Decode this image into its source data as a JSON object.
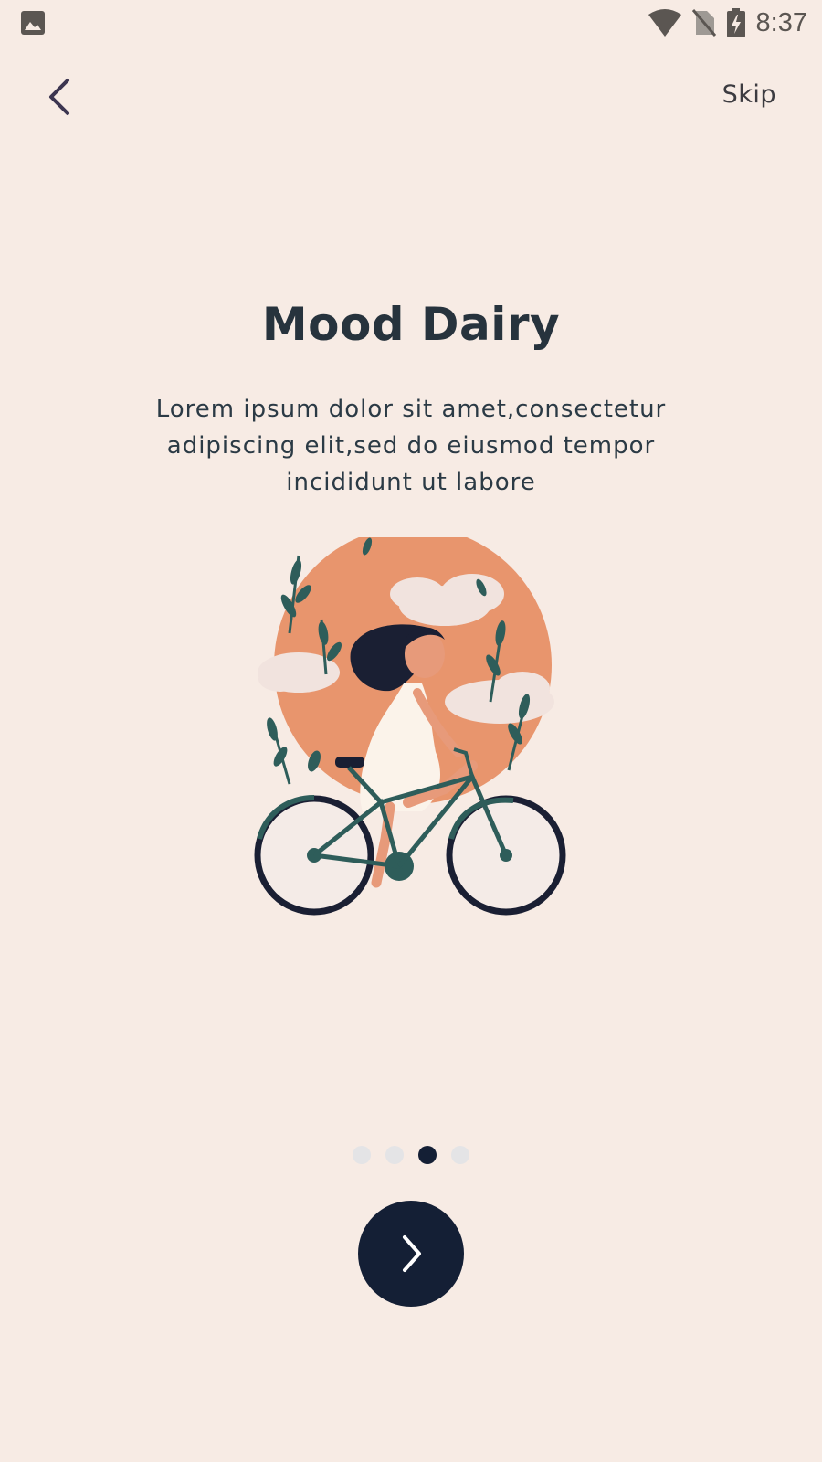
{
  "status_bar": {
    "time": "8:37",
    "icons": [
      "image-icon",
      "wifi-icon",
      "no-sim-icon",
      "battery-charging-icon"
    ]
  },
  "nav": {
    "back_icon": "chevron-left-icon",
    "skip_label": "Skip"
  },
  "onboarding": {
    "title": "Mood Dairy",
    "description": "Lorem ipsum dolor sit amet,consectetur adipiscing elit,sed do eiusmod tempor incididunt ut labore",
    "illustration": "woman-riding-bicycle-illustration",
    "page_count": 4,
    "current_page": 3
  },
  "next_button": {
    "icon": "chevron-right-icon"
  },
  "colors": {
    "background": "#f7ebe4",
    "primary": "#141f35",
    "accent": "#e8956d",
    "leaf": "#2e5d5a",
    "dot_inactive": "#e4e4e6"
  }
}
